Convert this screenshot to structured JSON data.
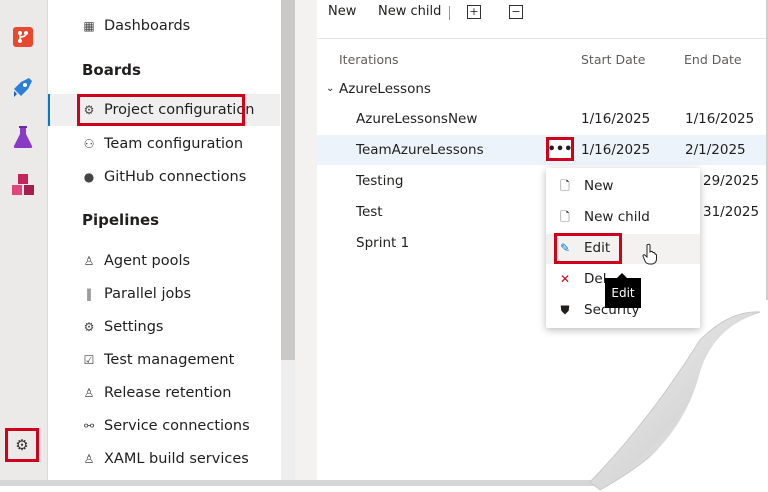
{
  "rail": {
    "icons": [
      "repos-icon",
      "pipelines-icon",
      "test-plans-icon",
      "artifacts-icon"
    ],
    "settings_icon": "gear-icon"
  },
  "sidebar": {
    "top_item": "Dashboards",
    "boards_heading": "Boards",
    "boards_items": [
      "Project configuration",
      "Team configuration",
      "GitHub connections"
    ],
    "pipelines_heading": "Pipelines",
    "pipelines_items": [
      "Agent pools",
      "Parallel jobs",
      "Settings",
      "Test management",
      "Release retention",
      "Service connections",
      "XAML build services"
    ]
  },
  "toolbar": {
    "new_label": "New",
    "new_child_label": "New child",
    "expand_icon": "+",
    "collapse_icon": "−"
  },
  "table": {
    "headers": {
      "iterations": "Iterations",
      "start": "Start Date",
      "end": "End Date"
    },
    "rows": [
      {
        "name": "AzureLessons",
        "start": "",
        "end": ""
      },
      {
        "name": "AzureLessonsNew",
        "start": "1/16/2025",
        "end": "1/16/2025"
      },
      {
        "name": "TeamAzureLessons",
        "start": "1/16/2025",
        "end": "2/1/2025"
      },
      {
        "name": "Testing",
        "start": "",
        "end": "29/2025"
      },
      {
        "name": "Test",
        "start": "",
        "end": "31/2025"
      },
      {
        "name": "Sprint 1",
        "start": "",
        "end": ""
      }
    ],
    "more_label": "•••"
  },
  "context_menu": {
    "items": [
      "New",
      "New child",
      "Edit",
      "Del",
      "Security"
    ]
  },
  "tooltip": "Edit",
  "colors": {
    "highlight": "#d0021b",
    "accent": "#0078d4"
  }
}
